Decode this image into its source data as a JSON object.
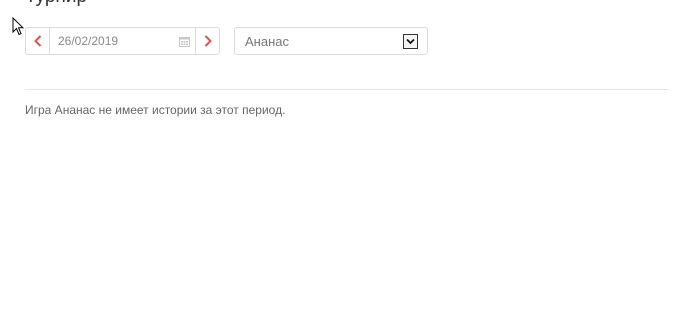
{
  "header": {
    "title": "Турнир"
  },
  "filters": {
    "date_value": "26/02/2019",
    "prev_icon": "chevron-left-icon",
    "next_icon": "chevron-right-icon",
    "calendar_icon": "calendar-icon",
    "game_selected": "Ананас",
    "arrow_icon": "chevron-down-icon"
  },
  "main": {
    "message": "Игра Ананас не имеет истории за этот период."
  },
  "colors": {
    "accent": "#d9534f",
    "border": "#dcdcdc",
    "text": "#666666"
  }
}
